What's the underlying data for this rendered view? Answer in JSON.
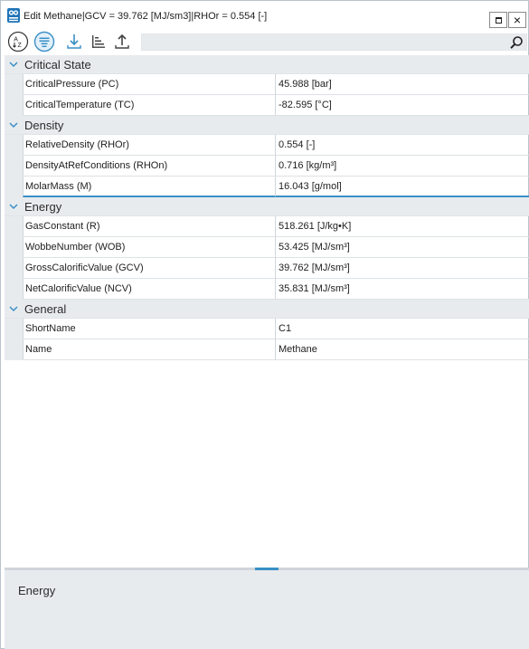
{
  "window": {
    "title": "Edit Methane|GCV =  39.762 [MJ/sm3]|RHOr =  0.554 [-]",
    "maximize_icon": "maximize-icon",
    "close_label": "×"
  },
  "toolbar": {
    "buttons": [
      {
        "name": "sort-alphabetical-button",
        "icon": "sort-az-icon"
      },
      {
        "name": "categorized-view-button",
        "icon": "categorized-icon",
        "active": true
      },
      {
        "name": "import-button",
        "icon": "download-icon"
      },
      {
        "name": "sort-ascending-button",
        "icon": "bars-icon"
      },
      {
        "name": "export-button",
        "icon": "upload-icon"
      }
    ],
    "search_value": "",
    "search_icon": "search-icon"
  },
  "colors": {
    "accent": "#3a8fc6",
    "category_bg": "#e8ebee",
    "chevron": "#3a8fc6"
  },
  "grid": {
    "categories": [
      {
        "label": "Critical State",
        "properties": [
          {
            "name": "CriticalPressure (PC)",
            "value": "45.988 [bar]"
          },
          {
            "name": "CriticalTemperature (TC)",
            "value": "-82.595 [°C]"
          }
        ]
      },
      {
        "label": "Density",
        "properties": [
          {
            "name": "RelativeDensity (RHOr)",
            "value": "0.554 [-]"
          },
          {
            "name": "DensityAtRefConditions (RHOn)",
            "value": "0.716 [kg/m³]"
          },
          {
            "name": "MolarMass (M)",
            "value": "16.043 [g/mol]"
          }
        ]
      },
      {
        "label": "Energy",
        "properties": [
          {
            "name": "GasConstant (R)",
            "value": "518.261 [J/kg•K]"
          },
          {
            "name": "WobbeNumber (WOB)",
            "value": "53.425 [MJ/sm³]"
          },
          {
            "name": "GrossCalorificValue (GCV)",
            "value": "39.762 [MJ/sm³]"
          },
          {
            "name": "NetCalorificValue (NCV)",
            "value": "35.831 [MJ/sm³]"
          }
        ]
      },
      {
        "label": "General",
        "properties": [
          {
            "name": "ShortName",
            "value": "C1"
          },
          {
            "name": "Name",
            "value": "Methane"
          }
        ]
      }
    ]
  },
  "description": {
    "title": "Energy"
  }
}
